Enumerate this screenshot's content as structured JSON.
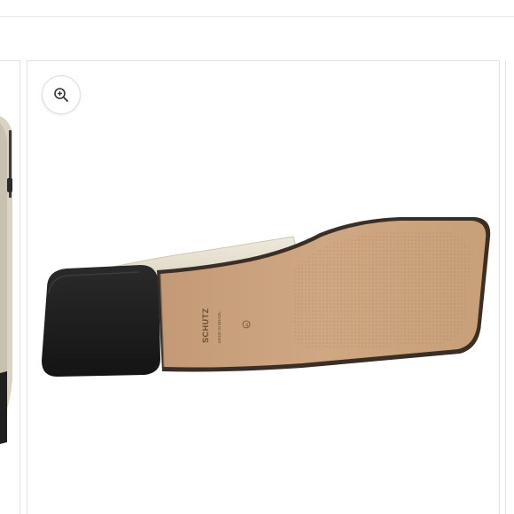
{
  "gallery": {
    "zoom_button": {
      "icon": "zoom-in-icon"
    },
    "main_image": {
      "subject": "square-toe bootie sole view",
      "sole_stamp": {
        "brand": "SCHUTZ",
        "size_text": "38",
        "made_in": "MADE IN BRAZIL"
      }
    },
    "colors": {
      "sole": "#c9a27e",
      "heel": "#1f1f1f",
      "upper": "#e8e2d3",
      "border": "#e3e3e3"
    }
  }
}
